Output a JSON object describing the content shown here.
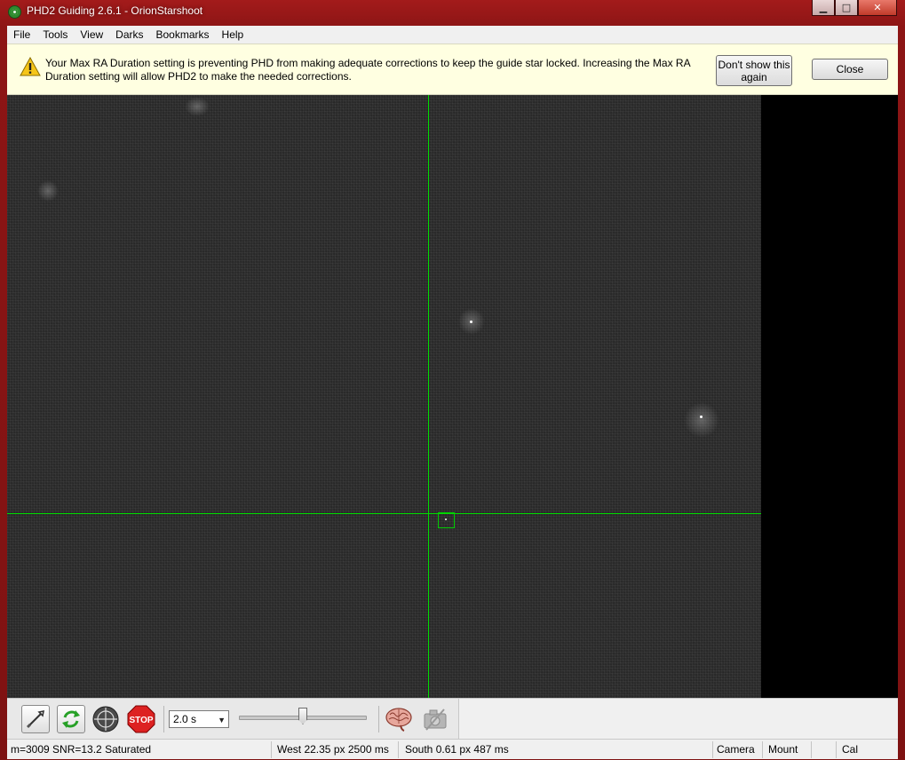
{
  "window": {
    "title": "PHD2 Guiding 2.6.1 - OrionStarshoot",
    "controls": {
      "minimize": "▁",
      "maximize": "□",
      "close": "✕"
    }
  },
  "menu": {
    "items": [
      "File",
      "Tools",
      "View",
      "Darks",
      "Bookmarks",
      "Help"
    ]
  },
  "infobar": {
    "message": "Your Max RA Duration setting is preventing PHD from making adequate corrections to keep the guide star locked. Increasing the Max RA Duration setting will allow PHD2 to make the needed corrections.",
    "dont_show_label": "Don't show this again",
    "close_label": "Close",
    "icon": "warning-icon"
  },
  "toolbar": {
    "icons": [
      "use-camera-icon",
      "loop-icon",
      "guide-crosshair-icon",
      "stop-icon",
      "brain-icon",
      "camera-settings-icon"
    ],
    "stop_label": "STOP",
    "exposure_value": "2.0 s",
    "gamma_slider_value": 0.5
  },
  "statusbar": {
    "star_info": "m=3009 SNR=13.2 Saturated",
    "ra_info": "West 22.35 px 2500 ms",
    "dec_info": "South 0.61 px 487 ms",
    "camera": "Camera",
    "mount": "Mount",
    "cal": "Cal"
  },
  "colors": {
    "crosshair": "#00dd00",
    "title_bar": "#a31b1b",
    "infobar_bg": "#ffffe1"
  }
}
